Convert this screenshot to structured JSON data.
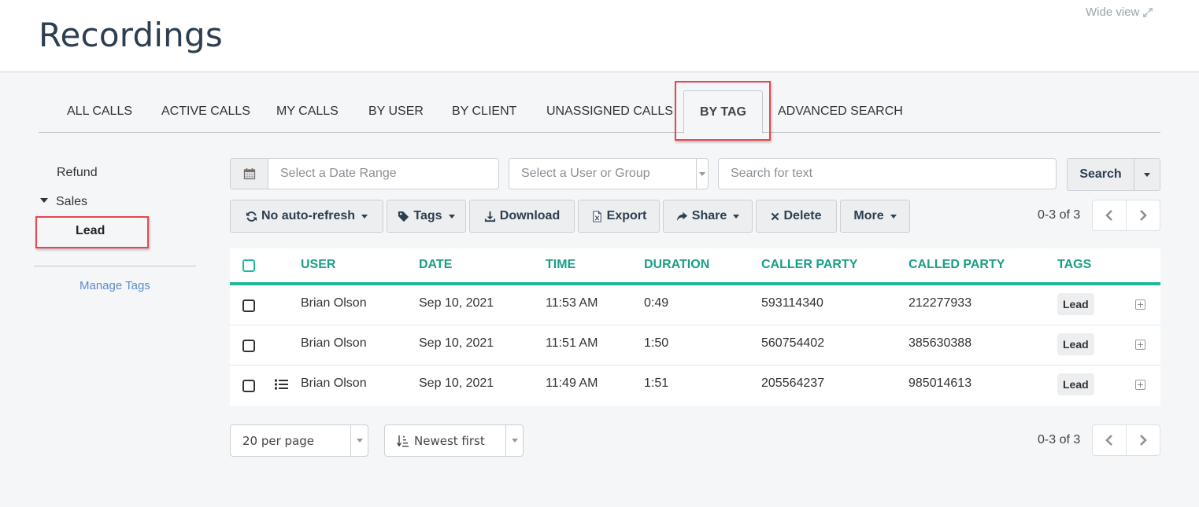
{
  "header": {
    "title": "Recordings",
    "wide_view_label": "Wide view",
    "wide_view_icon": "expand-icon"
  },
  "tabs": [
    {
      "label": "ALL CALLS",
      "active": false
    },
    {
      "label": "ACTIVE CALLS",
      "active": false
    },
    {
      "label": "MY CALLS",
      "active": false
    },
    {
      "label": "BY USER",
      "active": false
    },
    {
      "label": "BY CLIENT",
      "active": false
    },
    {
      "label": "UNASSIGNED CALLS",
      "active": false
    },
    {
      "label": "BY TAG",
      "active": true
    },
    {
      "label": "ADVANCED SEARCH",
      "active": false
    }
  ],
  "sidebar": {
    "tags": [
      {
        "label": "Refund",
        "level": 0
      },
      {
        "label": "Sales",
        "level": 0,
        "expanded": true
      },
      {
        "label": "Lead",
        "level": 1,
        "selected": true
      }
    ],
    "manage_tags_label": "Manage Tags"
  },
  "filters": {
    "date_range_placeholder": "Select a Date Range",
    "date_range_icon": "calendar-icon",
    "user_group_placeholder": "Select a User or Group",
    "search_text_placeholder": "Search for text",
    "search_label": "Search"
  },
  "toolbar": {
    "auto_refresh_label": "No auto-refresh",
    "tags_label": "Tags",
    "download_label": "Download",
    "export_label": "Export",
    "share_label": "Share",
    "delete_label": "Delete",
    "more_label": "More"
  },
  "pagination": {
    "range_text": "0-3 of 3"
  },
  "table": {
    "columns": [
      "USER",
      "DATE",
      "TIME",
      "DURATION",
      "CALLER PARTY",
      "CALLED PARTY",
      "TAGS"
    ],
    "rows": [
      {
        "user": "Brian Olson",
        "date": "Sep 10, 2021",
        "time": "11:53 AM",
        "duration": "0:49",
        "caller": "593114340",
        "called": "212277933",
        "tag": "Lead",
        "has_notes": false
      },
      {
        "user": "Brian Olson",
        "date": "Sep 10, 2021",
        "time": "11:51 AM",
        "duration": "1:50",
        "caller": "560754402",
        "called": "385630388",
        "tag": "Lead",
        "has_notes": false
      },
      {
        "user": "Brian Olson",
        "date": "Sep 10, 2021",
        "time": "11:49 AM",
        "duration": "1:51",
        "caller": "205564237",
        "called": "985014613",
        "tag": "Lead",
        "has_notes": true
      }
    ]
  },
  "footer": {
    "per_page_value": "20 per page",
    "sort_value": "Newest first"
  },
  "colors": {
    "accent": "#1fb999",
    "header_text": "#1a9e86",
    "highlight": "#e8474f",
    "link": "#5b8cc8",
    "title": "#2c3e50"
  }
}
